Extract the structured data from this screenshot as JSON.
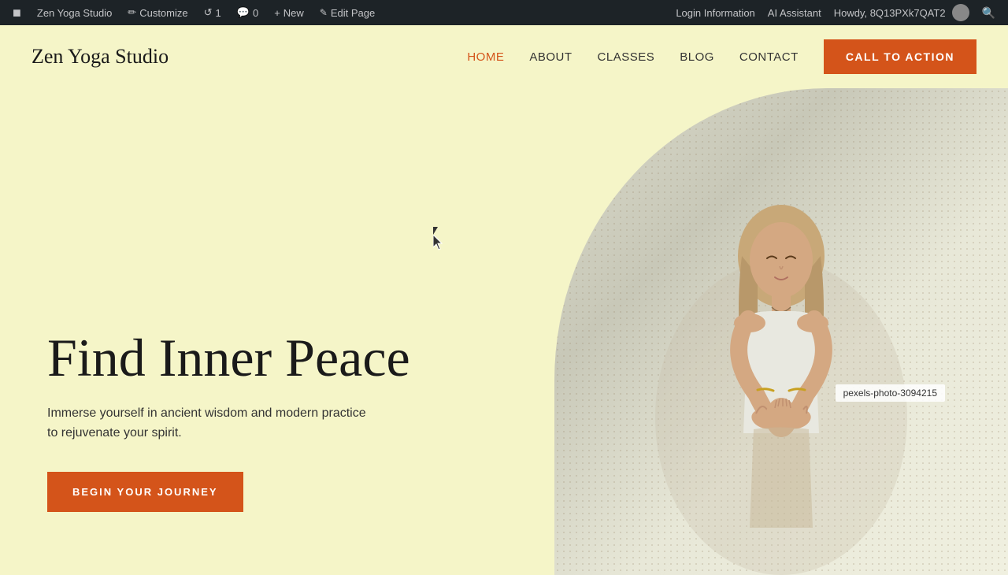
{
  "admin_bar": {
    "wp_icon": "⊞",
    "site_name": "Zen Yoga Studio",
    "customize_label": "Customize",
    "revisions_label": "1",
    "comments_label": "0",
    "new_label": "New",
    "edit_page_label": "Edit Page",
    "login_info_label": "Login Information",
    "ai_assistant_label": "AI Assistant",
    "howdy_label": "Howdy, 8Q13PXk7QAT2",
    "search_icon": "🔍"
  },
  "header": {
    "logo": "Zen Yoga Studio",
    "nav": {
      "home": "HOME",
      "about": "ABOUT",
      "classes": "CLASSES",
      "blog": "BLOG",
      "contact": "CONTACT"
    },
    "cta": "CALL TO ACTION"
  },
  "hero": {
    "title": "Find Inner Peace",
    "subtitle": "Immerse yourself in ancient wisdom and modern practice to rejuvenate your spirit.",
    "cta": "BEGIN YOUR JOURNEY",
    "image_label": "pexels-photo-3094215"
  },
  "colors": {
    "accent": "#d4541a",
    "bg": "#f5f5c8",
    "admin_bg": "#1d2327",
    "text_dark": "#1a1a1a",
    "text_mid": "#333333",
    "nav_active": "#d4541a"
  }
}
